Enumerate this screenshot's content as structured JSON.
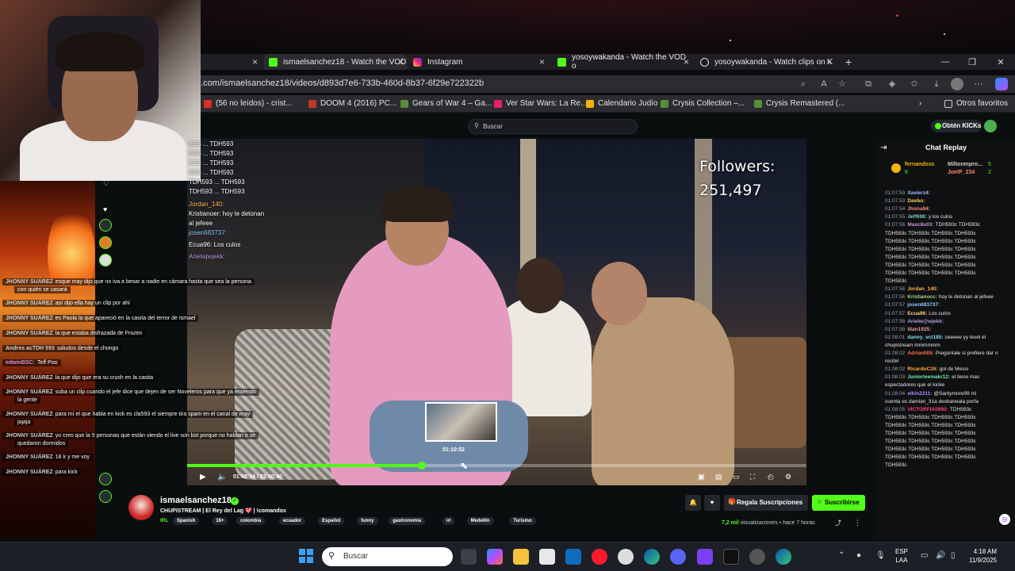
{
  "browser": {
    "tabs": [
      {
        "label": "ismaelsanchez18 - Watch the VOD",
        "active": true
      },
      {
        "label": "Instagram"
      },
      {
        "label": "yosoywakanda - Watch the VOD o"
      },
      {
        "label": "yosoywakanda - Watch clips on K"
      }
    ],
    "new_tab": "+",
    "url": ".com/ismaelsanchez18/videos/d893d7e6-733b-460d-8b37-6f29e722322b",
    "bookmarks": [
      "(56 no leídos) - crist...",
      "DOOM 4 (2016) PC...",
      "Gears of War 4 – Ga...",
      "Ver Star Wars: La Re...",
      "Calendario Judío",
      "Crysis Collection –...",
      "Crysis Remastered (..."
    ],
    "other_favorites": "Otros favoritos"
  },
  "kick": {
    "search_placeholder": "Buscar",
    "kicks_label": "Obtén KICKs"
  },
  "video": {
    "followers_label": "Followers:",
    "followers_count": "251,497",
    "current_time": "01:08:04",
    "duration": "03:00:40",
    "preview_time": "01:10:52",
    "progress_fraction": 0.378
  },
  "overlay_chat": [
    "I593 ... TDH593",
    "I593 ... TDH593",
    "I593 ... TDH593",
    "I593 ... TDH593",
    "TDH593 ... TDH593",
    "TDH593 ... TDH593",
    "Jordan_140:",
    "Kristianoer: hoy le detonan",
    "al jefeee",
    "josen683737:",
    "Ecua96: Los culos",
    "Arielwjwjekk:"
  ],
  "left_chat": [
    {
      "user": "JHONNY SUÁREZ",
      "text": "esque may dijo que no iva a besar a nadie en cámara hasta que sea la persona",
      "text2": "con quién se casará"
    },
    {
      "user": "JHONNY SUÁREZ",
      "text": "así dijo ella hay un clip por ahí"
    },
    {
      "user": "JHONNY SUÁREZ",
      "text": "es Paola la que apareció en la casita del terror de Ismael"
    },
    {
      "user": "JHONNY SUÁREZ",
      "text": "la que estaba disfrazada de Frozen"
    },
    {
      "user": "Andres acTDH 593",
      "text": "saludos desde el chongo"
    },
    {
      "user": "edwinBSC:",
      "text": "Teff Poo"
    },
    {
      "user": "JHONNY SUÁREZ",
      "text": "la que dijo que era su crush en la casita"
    },
    {
      "user": "JHONNY SUÁREZ",
      "text": "suba un clip cuando el jefe dice que dejen de ser Noveleros para que ya entiendo",
      "text2": "la gente"
    },
    {
      "user": "JHONNY SUÁREZ",
      "text": "para mí el que habla en kick es cla593 el siempre tira spam en el canal de may",
      "text2": "jajaja"
    },
    {
      "user": "JHONNY SUÁREZ",
      "text": "yo creo que la 5 personas que están viendo el live son bot porque no hablan o se",
      "text2": "quedaron dormidos"
    },
    {
      "user": "JHONNY SUÁREZ",
      "text": "18 k y me voy"
    },
    {
      "user": "JHONNY SUÁREZ",
      "text": "para kick"
    }
  ],
  "chat": {
    "title": "Chat Replay",
    "pinned": [
      {
        "user": "fernandoxc",
        "count": "6"
      },
      {
        "user": "Miltonmpro...",
        "count": "5"
      },
      {
        "user": "JoelP_234",
        "count": "2"
      }
    ],
    "messages": [
      {
        "ts": "01:07:53",
        "user": "Xavierz4:",
        "text": "",
        "color": "#a0c4ff"
      },
      {
        "ts": "01:07:53",
        "user": "Davbo:",
        "text": "",
        "color": "#ffd54f"
      },
      {
        "ts": "01:07:54",
        "user": "Jhona94:",
        "text": "",
        "color": "#ff8a80"
      },
      {
        "ts": "01:07:55",
        "user": "Jeff698:",
        "text": "y los culos",
        "color": "#80cbc4"
      },
      {
        "ts": "01:07:56",
        "user": "Maxc8o03:",
        "text": "TDH593c TDH593c",
        "color": "#ce93d8"
      },
      {
        "ts": "",
        "user": "",
        "text": "TDH593c TDH593c TDH593c TDH593c",
        "color": "#fff"
      },
      {
        "ts": "",
        "user": "",
        "text": "TDH593c TDH593c TDH593c TDH593c",
        "color": "#fff"
      },
      {
        "ts": "",
        "user": "",
        "text": "TDH593c TDH593c TDH593c TDH593c",
        "color": "#fff"
      },
      {
        "ts": "",
        "user": "",
        "text": "TDH593c TDH593c TDH593c TDH593c",
        "color": "#fff"
      },
      {
        "ts": "",
        "user": "",
        "text": "TDH593c TDH593c TDH593c TDH593c",
        "color": "#fff"
      },
      {
        "ts": "",
        "user": "",
        "text": "TDH593c TDH593c TDH593c TDH593c",
        "color": "#fff"
      },
      {
        "ts": "",
        "user": "",
        "text": "TDH593c",
        "color": "#fff"
      },
      {
        "ts": "01:07:56",
        "user": "Jordan_140:",
        "text": "",
        "color": "#ffb74d"
      },
      {
        "ts": "01:07:56",
        "user": "Kristianocc:",
        "text": "hoy le detonan al jefeee",
        "color": "#aed581"
      },
      {
        "ts": "01:07:57",
        "user": "josen683737:",
        "text": "",
        "color": "#90caf9"
      },
      {
        "ts": "01:07:57",
        "user": "Ecua96:",
        "text": "Los culos",
        "color": "#ffcc80"
      },
      {
        "ts": "01:07:58",
        "user": "Arielw@wjekk:",
        "text": "",
        "color": "#b39ddb"
      },
      {
        "ts": "01:07:59",
        "user": "tilan1925:",
        "text": "",
        "color": "#ef9a9a"
      },
      {
        "ts": "01:08:01",
        "user": "danny_vct185:",
        "text": "ceeeee yy level el",
        "color": "#80deea"
      },
      {
        "ts": "",
        "user": "",
        "text": "chupistream mmmmmm",
        "color": "#fff"
      },
      {
        "ts": "01:08:02",
        "user": "Adrian005:",
        "text": "Pregúntale si prefiere dar o",
        "color": "#ff7043"
      },
      {
        "ts": "",
        "user": "",
        "text": "recibir",
        "color": "#fff"
      },
      {
        "ts": "01:08:02",
        "user": "RicardoC26:",
        "text": "gol de Messi",
        "color": "#ffab40"
      },
      {
        "ts": "01:08:03",
        "user": "Juniorleemakr12:",
        "text": "el tiene mas",
        "color": "#69f0ae"
      },
      {
        "ts": "",
        "user": "",
        "text": "espectadores que el kicke",
        "color": "#fff"
      },
      {
        "ts": "01:08:04",
        "user": "elkin2211:",
        "text": "@Santymore99 mi",
        "color": "#b388ff"
      },
      {
        "ts": "",
        "user": "",
        "text": "cuenta es damian_31a desbaneala porfa",
        "color": "#fff"
      },
      {
        "ts": "01:08:05",
        "user": "VICTORFIA0890:",
        "text": "TDH593c",
        "color": "#ff4081"
      },
      {
        "ts": "",
        "user": "",
        "text": "TDH593c TDH593c TDH593c TDH593c",
        "color": "#fff"
      },
      {
        "ts": "",
        "user": "",
        "text": "TDH593c TDH593c TDH593c TDH593c",
        "color": "#fff"
      },
      {
        "ts": "",
        "user": "",
        "text": "TDH593c TDH593c TDH593c TDH593c",
        "color": "#fff"
      },
      {
        "ts": "",
        "user": "",
        "text": "TDH593c TDH593c TDH593c TDH593c",
        "color": "#fff"
      },
      {
        "ts": "",
        "user": "",
        "text": "TDH593c TDH593c TDH593c TDH593c",
        "color": "#fff"
      },
      {
        "ts": "",
        "user": "",
        "text": "TDH593c TDH593c TDH593c TDH593c",
        "color": "#fff"
      },
      {
        "ts": "",
        "user": "",
        "text": "TDH593c",
        "color": "#fff"
      }
    ]
  },
  "channel": {
    "name": "ismaelsanchez18",
    "title": "CHUPISTREAM | El Rey del Lag 💖 | !comandos",
    "category": "IRL",
    "tags": [
      "Spanish",
      "18+",
      "colombia",
      "ecuador",
      "Español",
      "funny",
      "gastronomía",
      "irl",
      "Medellín",
      "Turismo"
    ],
    "gift_label": "Regala Suscripciones",
    "subscribe_label": "Suscribirse",
    "views": "7,2 mil",
    "views_suffix": "visualizaciones",
    "ago": "hace 7 horas"
  },
  "taskbar": {
    "search_placeholder": "Buscar",
    "lang1": "ESP",
    "lang2": "LAA",
    "time": "4:18 AM",
    "date": "11/9/2025"
  },
  "colors": {
    "kick_green": "#53fc18"
  }
}
